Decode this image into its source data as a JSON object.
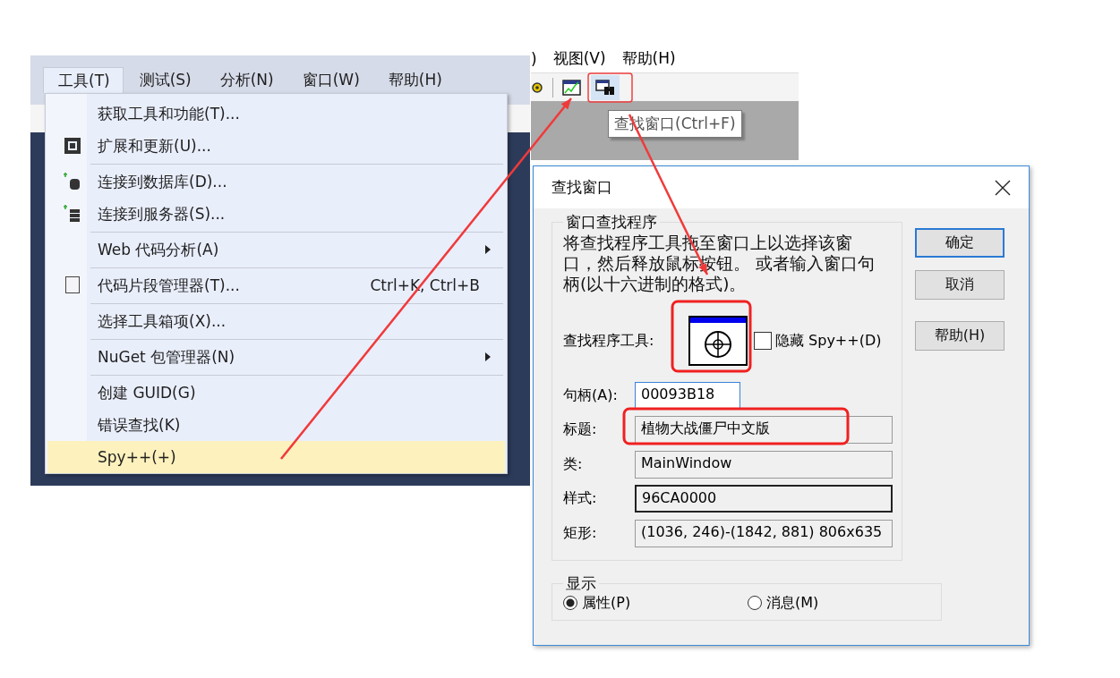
{
  "vs_menu": {
    "menubar": [
      {
        "label": "工具(T)",
        "selected": true
      },
      {
        "label": "测试(S)",
        "selected": false
      },
      {
        "label": "分析(N)",
        "selected": false
      },
      {
        "label": "窗口(W)",
        "selected": false
      },
      {
        "label": "帮助(H)",
        "selected": false
      }
    ],
    "items": [
      {
        "label": "获取工具和功能(T)...",
        "separator_after": false,
        "submenu": false,
        "selected": false
      },
      {
        "label": "扩展和更新(U)...",
        "separator_after": true,
        "submenu": false,
        "selected": false
      },
      {
        "label": "连接到数据库(D)...",
        "separator_after": false,
        "submenu": false,
        "selected": false
      },
      {
        "label": "连接到服务器(S)...",
        "separator_after": true,
        "submenu": false,
        "selected": false
      },
      {
        "label": "Web 代码分析(A)",
        "separator_after": true,
        "submenu": true,
        "selected": false
      },
      {
        "label": "代码片段管理器(T)...",
        "shortcut": "Ctrl+K, Ctrl+B",
        "separator_after": true,
        "submenu": false,
        "selected": false
      },
      {
        "label": "选择工具箱项(X)...",
        "separator_after": true,
        "submenu": false,
        "selected": false
      },
      {
        "label": "NuGet 包管理器(N)",
        "separator_after": true,
        "submenu": true,
        "selected": false
      },
      {
        "label": "创建 GUID(G)",
        "separator_after": false,
        "submenu": false,
        "selected": false
      },
      {
        "label": "错误查找(K)",
        "separator_after": false,
        "submenu": false,
        "selected": false
      },
      {
        "label": "Spy++(+)",
        "separator_after": false,
        "submenu": false,
        "selected": true
      }
    ]
  },
  "spy_toolbar": {
    "menubar": [
      {
        "label": ")"
      },
      {
        "label": "视图(V)"
      },
      {
        "label": "帮助(H)"
      }
    ],
    "tooltip": "查找窗口(Ctrl+F)"
  },
  "find_dialog": {
    "title": "查找窗口",
    "finder_group": {
      "title": "窗口查找程序",
      "description": "将查找程序工具拖至窗口上以选择该窗口，然后释放鼠标按钮。 或者输入窗口句柄(以十六进制的格式)。",
      "tool_label": "查找程序工具:",
      "hide_checkbox": {
        "label": "隐藏 Spy++(D)",
        "checked": false
      }
    },
    "fields": [
      {
        "label": "句柄(A):",
        "value": "00093B18",
        "kind": "edit"
      },
      {
        "label": "标题:",
        "value": "植物大战僵尸中文版",
        "kind": "readonly"
      },
      {
        "label": "类:",
        "value": "MainWindow",
        "kind": "readonly"
      },
      {
        "label": "样式:",
        "value": "96CA0000",
        "kind": "framed"
      },
      {
        "label": "矩形:",
        "value": "(1036, 246)-(1842, 881) 806x635",
        "kind": "readonly"
      }
    ],
    "display_group": {
      "title": "显示",
      "options": [
        {
          "label": "属性(P)",
          "selected": true
        },
        {
          "label": "消息(M)",
          "selected": false
        }
      ]
    },
    "buttons": [
      {
        "label": "确定",
        "default": true
      },
      {
        "label": "取消",
        "default": false
      },
      {
        "label": "帮助(H)",
        "default": false
      }
    ]
  }
}
